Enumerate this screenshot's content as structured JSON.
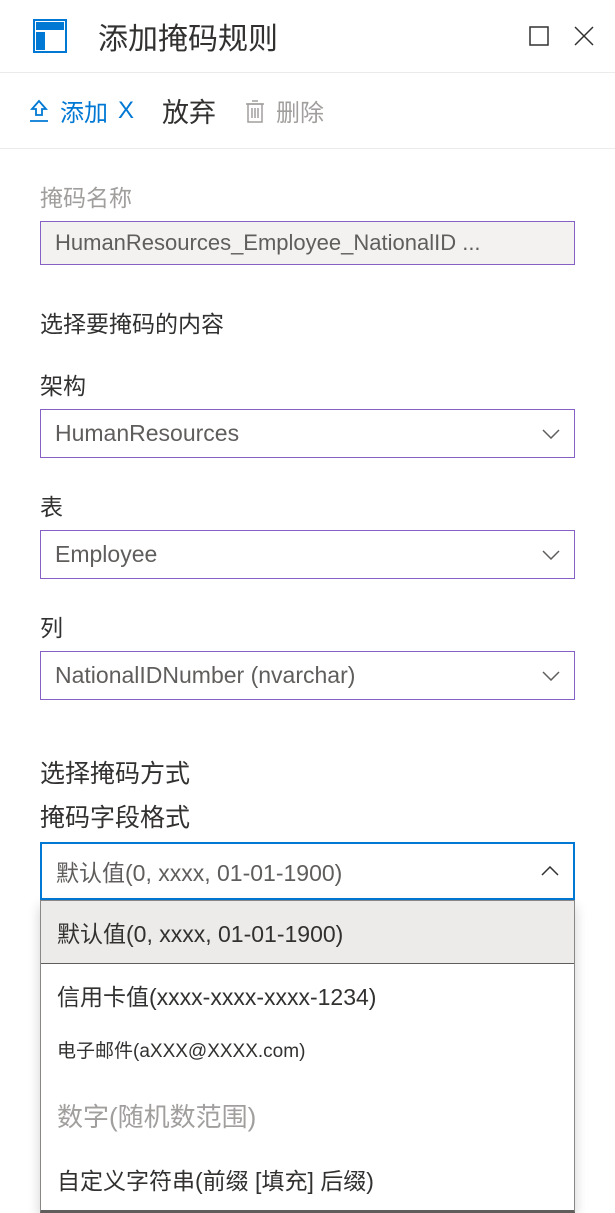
{
  "header": {
    "title": "添加掩码规则"
  },
  "toolbar": {
    "add_label": "添加",
    "discard_label": "放弃",
    "delete_label": "删除"
  },
  "form": {
    "mask_name_label": "掩码名称",
    "mask_name_value": "HumanResources_Employee_NationalID   ...",
    "select_content_label": "选择要掩码的内容",
    "schema_label": "架构",
    "schema_value": "HumanResources",
    "table_label": "表",
    "table_value": "Employee",
    "column_label": "列",
    "column_value": "NationalIDNumber (nvarchar)",
    "select_method_label": "选择掩码方式",
    "mask_format_label": "掩码字段格式",
    "mask_format_value": "默认值(0, xxxx, 01-01-1900)",
    "options": {
      "default": "默认值(0, xxxx, 01-01-1900)",
      "creditcard": "信用卡值(xxxx-xxxx-xxxx-1234)",
      "email": "电子邮件(aXXX@XXXX.com)",
      "number": "数字(随机数范围)",
      "custom": "自定义字符串(前缀 [填充] 后缀)"
    }
  },
  "colors": {
    "primary": "#0078d4",
    "border": "#8661c5"
  }
}
